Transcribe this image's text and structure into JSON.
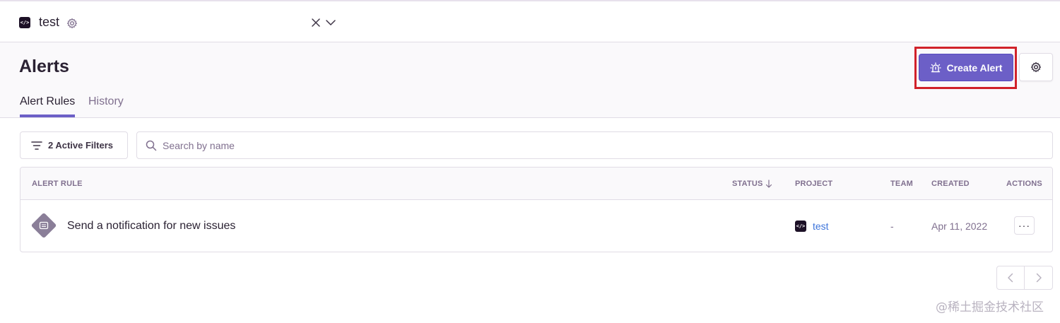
{
  "project_bar": {
    "icon_text": "</>",
    "project_name": "test"
  },
  "header": {
    "title": "Alerts",
    "tabs": [
      {
        "label": "Alert Rules",
        "active": true
      },
      {
        "label": "History",
        "active": false
      }
    ],
    "create_alert_label": "Create Alert"
  },
  "filters": {
    "active_filters_label": "2 Active Filters",
    "search_placeholder": "Search by name"
  },
  "table": {
    "columns": {
      "alert_rule": "ALERT RULE",
      "status": "STATUS",
      "project": "PROJECT",
      "team": "TEAM",
      "created": "CREATED",
      "actions": "ACTIONS"
    },
    "rows": [
      {
        "name": "Send a notification for new issues",
        "project_icon_text": "</>",
        "project": "test",
        "team": "-",
        "created": "Apr 11, 2022",
        "actions_label": "···"
      }
    ]
  },
  "watermark": "@稀土掘金技术社区",
  "colors": {
    "accent": "#6c5fc7",
    "highlight_border": "#d1222a",
    "link": "#3d74db"
  }
}
